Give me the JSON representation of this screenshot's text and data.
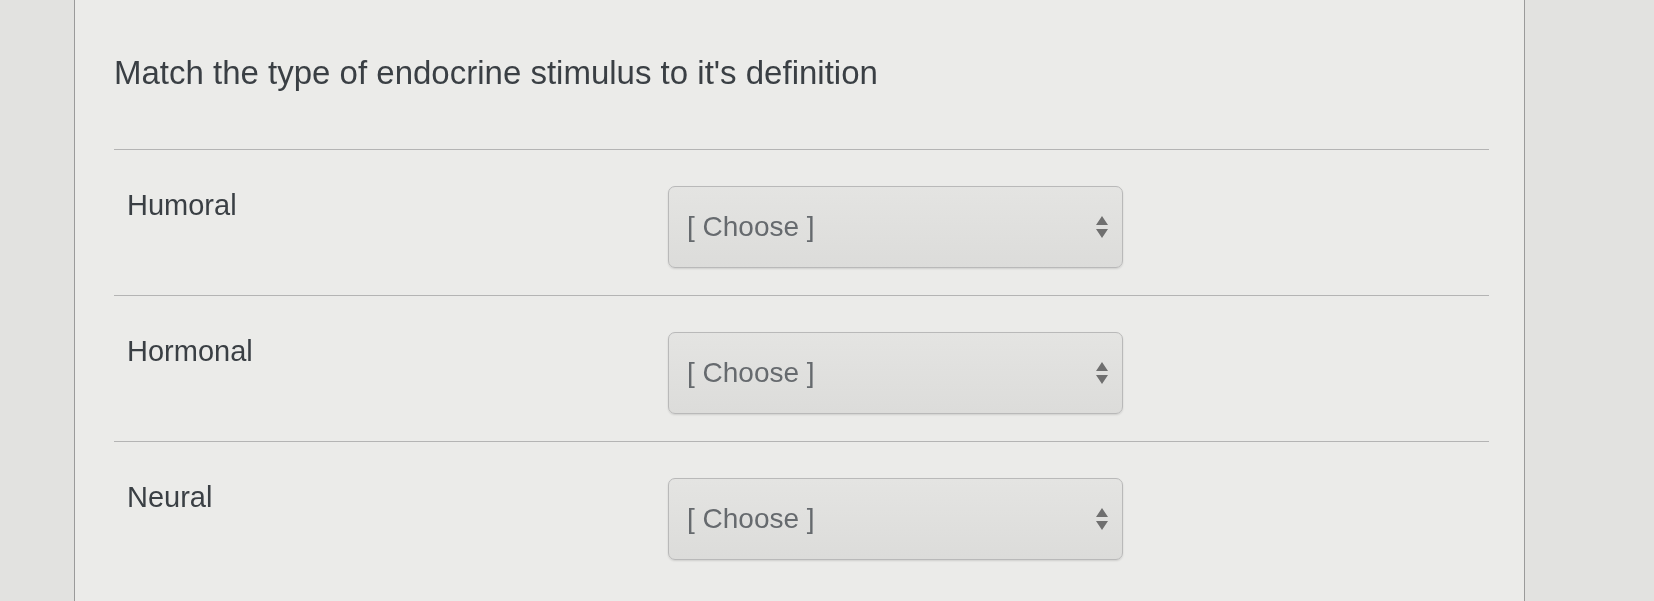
{
  "question": {
    "prompt": "Match the type of endocrine stimulus to it's definition"
  },
  "matches": [
    {
      "term": "Humoral",
      "dropdown": {
        "value": "[ Choose ]"
      }
    },
    {
      "term": "Hormonal",
      "dropdown": {
        "value": "[ Choose ]"
      }
    },
    {
      "term": "Neural",
      "dropdown": {
        "value": "[ Choose ]"
      }
    }
  ]
}
